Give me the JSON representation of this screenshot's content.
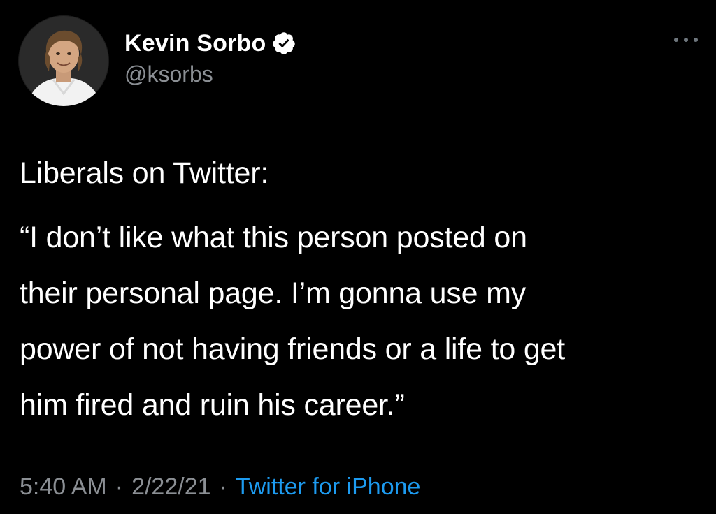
{
  "author": {
    "display_name": "Kevin Sorbo",
    "handle": "@ksorbs",
    "verified": true
  },
  "icons": {
    "avatar": "profile-photo",
    "verified": "verified-badge-icon",
    "more": "more-options-icon"
  },
  "tweet": {
    "line1": "Liberals on Twitter:",
    "quote_lines": [
      "“I don’t like what this person posted on",
      "their personal page. I’m gonna use my",
      "power of not having friends or a life to get",
      "him fired and ruin his career.”"
    ]
  },
  "meta": {
    "time": "5:40 AM",
    "separator": "·",
    "date": "2/22/21",
    "source": "Twitter for iPhone"
  },
  "colors": {
    "background": "#000000",
    "text": "#ffffff",
    "secondary": "#8b8f94",
    "link": "#1d9bf0",
    "verified": "#ffffff"
  }
}
